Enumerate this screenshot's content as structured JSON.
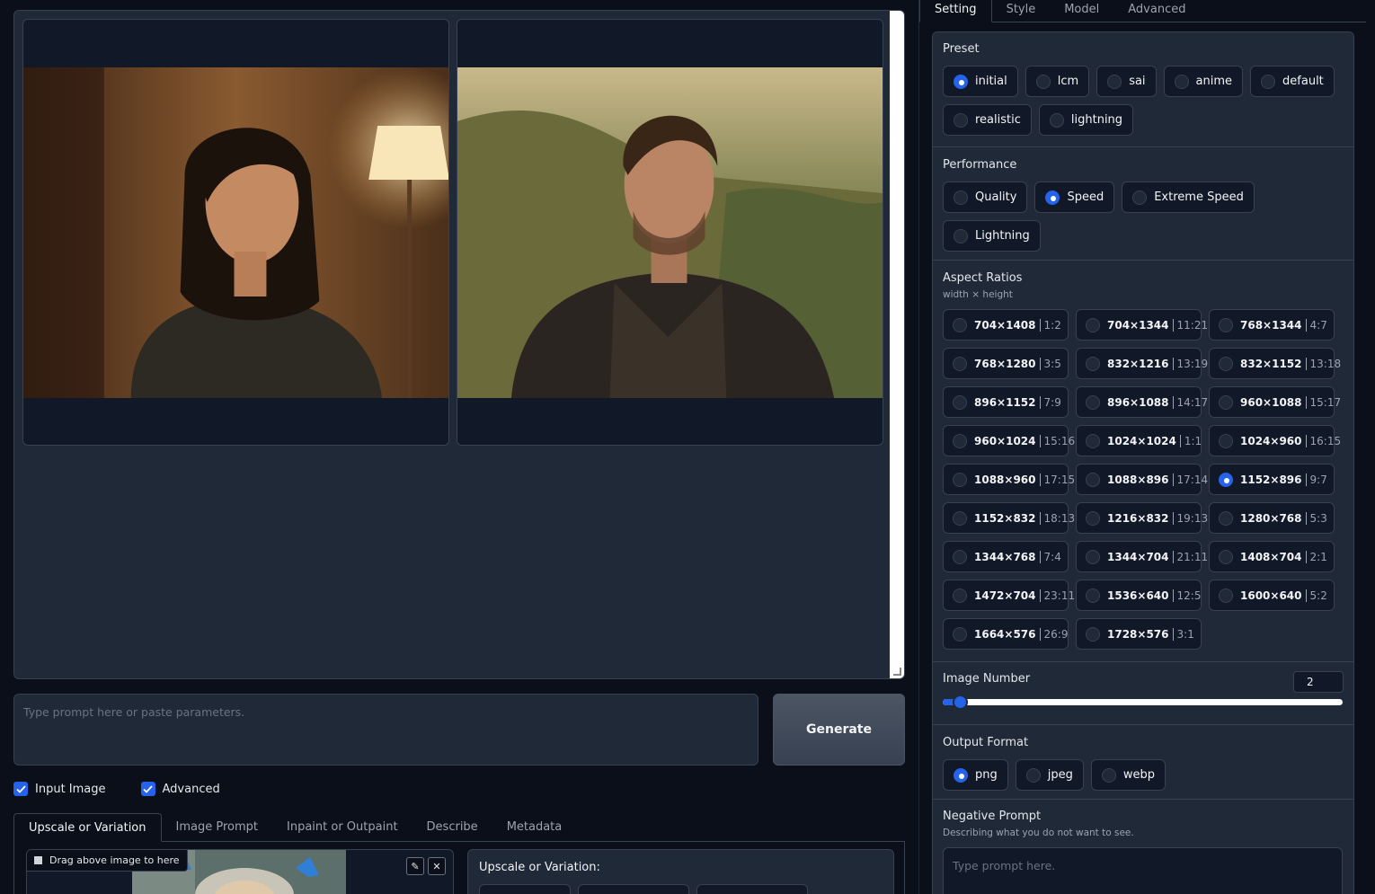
{
  "prompt": {
    "placeholder": "Type prompt here or paste parameters."
  },
  "generate_label": "Generate",
  "checkboxes": [
    {
      "label": "Input Image",
      "checked": true
    },
    {
      "label": "Advanced",
      "checked": true
    }
  ],
  "left_tabs": [
    "Upscale or Variation",
    "Image Prompt",
    "Inpaint or Outpaint",
    "Describe",
    "Metadata"
  ],
  "upload": {
    "drag_label": "Drag above image to here"
  },
  "variation": {
    "title": "Upscale or Variation:"
  },
  "right_tabs": [
    "Setting",
    "Style",
    "Model",
    "Advanced"
  ],
  "preset": {
    "title": "Preset",
    "options": [
      "initial",
      "lcm",
      "sai",
      "anime",
      "default",
      "realistic",
      "lightning"
    ],
    "selected": "initial"
  },
  "performance": {
    "title": "Performance",
    "options": [
      "Quality",
      "Speed",
      "Extreme Speed",
      "Lightning"
    ],
    "selected": "Speed"
  },
  "aspect": {
    "title": "Aspect Ratios",
    "subtitle": "width × height",
    "options": [
      {
        "size": "704×1408",
        "ratio": "1:2"
      },
      {
        "size": "704×1344",
        "ratio": "11:21"
      },
      {
        "size": "768×1344",
        "ratio": "4:7"
      },
      {
        "size": "768×1280",
        "ratio": "3:5"
      },
      {
        "size": "832×1216",
        "ratio": "13:19"
      },
      {
        "size": "832×1152",
        "ratio": "13:18"
      },
      {
        "size": "896×1152",
        "ratio": "7:9"
      },
      {
        "size": "896×1088",
        "ratio": "14:17"
      },
      {
        "size": "960×1088",
        "ratio": "15:17"
      },
      {
        "size": "960×1024",
        "ratio": "15:16"
      },
      {
        "size": "1024×1024",
        "ratio": "1:1"
      },
      {
        "size": "1024×960",
        "ratio": "16:15"
      },
      {
        "size": "1088×960",
        "ratio": "17:15"
      },
      {
        "size": "1088×896",
        "ratio": "17:14"
      },
      {
        "size": "1152×896",
        "ratio": "9:7"
      },
      {
        "size": "1152×832",
        "ratio": "18:13"
      },
      {
        "size": "1216×832",
        "ratio": "19:13"
      },
      {
        "size": "1280×768",
        "ratio": "5:3"
      },
      {
        "size": "1344×768",
        "ratio": "7:4"
      },
      {
        "size": "1344×704",
        "ratio": "21:11"
      },
      {
        "size": "1408×704",
        "ratio": "2:1"
      },
      {
        "size": "1472×704",
        "ratio": "23:11"
      },
      {
        "size": "1536×640",
        "ratio": "12:5"
      },
      {
        "size": "1600×640",
        "ratio": "5:2"
      },
      {
        "size": "1664×576",
        "ratio": "26:9"
      },
      {
        "size": "1728×576",
        "ratio": "3:1"
      }
    ],
    "selected": "1152×896"
  },
  "image_number": {
    "title": "Image Number",
    "value": "2",
    "fraction": 0.02
  },
  "output_format": {
    "title": "Output Format",
    "options": [
      "png",
      "jpeg",
      "webp"
    ],
    "selected": "png"
  },
  "negative": {
    "title": "Negative Prompt",
    "subtitle": "Describing what you do not want to see.",
    "placeholder": "Type prompt here."
  },
  "colors": {
    "accent": "#2563eb",
    "panel": "#1f2937",
    "background": "#0b0f19",
    "border": "#374151"
  }
}
